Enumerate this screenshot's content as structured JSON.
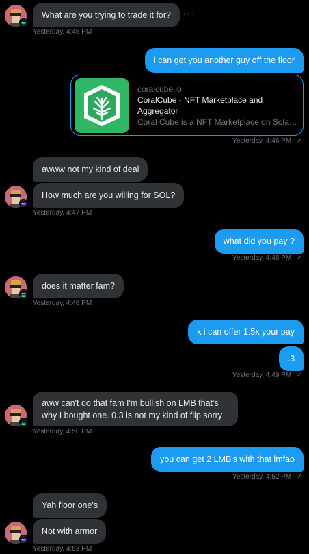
{
  "conversation": {
    "msg1": {
      "text": "What are you trying to trade it for?",
      "time": "Yesterday, 4:45 PM",
      "more": "···"
    },
    "msg2": {
      "text": "i can get you another guy off the floor"
    },
    "link_card": {
      "domain": "coralcube.io",
      "title": "CoralCube - NFT Marketplace and Aggregator",
      "description": "Coral Cube is a NFT Marketplace on Solana with aggregated listings",
      "time": "Yesterday, 4:46 PM"
    },
    "msg3": {
      "text": "awww not my kind of deal"
    },
    "msg4": {
      "text": "How much are you willing for SOL?",
      "time": "Yesterday, 4:47 PM"
    },
    "msg5": {
      "text": "what did you pay ?",
      "time": "Yesterday, 4:48 PM"
    },
    "msg6": {
      "text": "does it matter fam?",
      "time": "Yesterday, 4:48 PM"
    },
    "msg7": {
      "text": "k i can offer 1.5x your pay"
    },
    "msg8": {
      "text": ".3",
      "time": "Yesterday, 4:49 PM"
    },
    "msg9": {
      "text": "aww can't do that fam I'm bullish on LMB that's why I bought one. 0.3 is not my kind of flip sorry",
      "time": "Yesterday, 4:50 PM"
    },
    "msg10": {
      "text": "you can get 2 LMB's with that lmfao",
      "time": "Yesterday, 4:52 PM"
    },
    "msg11": {
      "text": "Yah floor one's"
    },
    "msg12": {
      "text": "Not with armor",
      "time": "Yesterday, 4:53 PM"
    },
    "read_icon": "✓",
    "colors": {
      "incoming": "#2f3336",
      "outgoing": "#1d9bf0",
      "background": "#000000"
    }
  }
}
